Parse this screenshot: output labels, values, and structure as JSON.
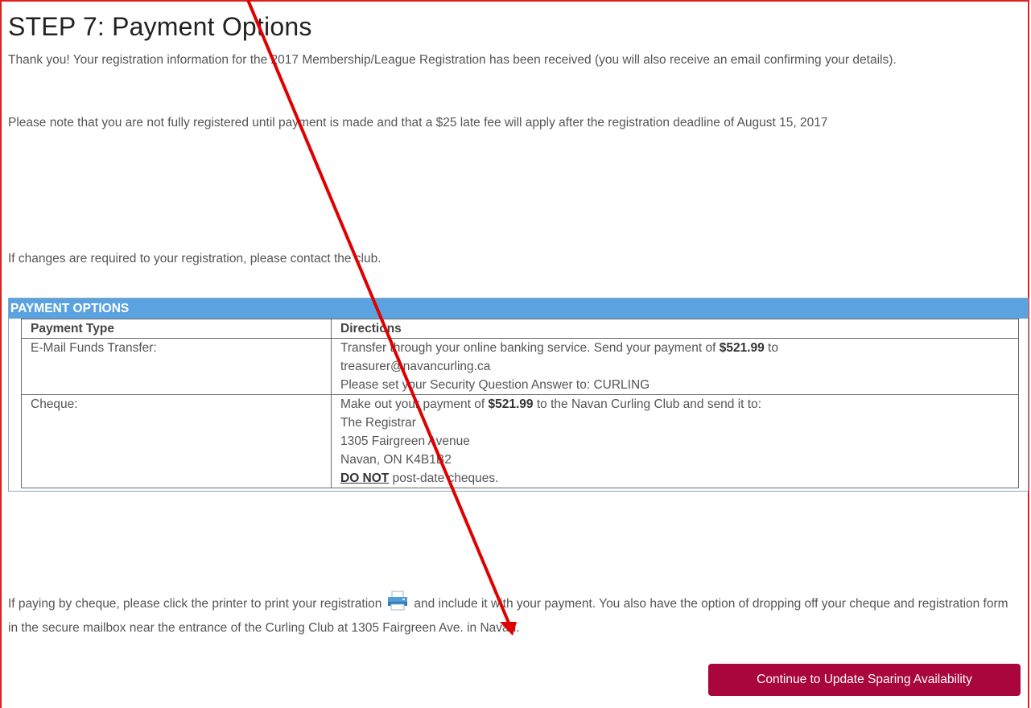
{
  "heading": "STEP 7: Payment Options",
  "paragraphs": {
    "thanks": "Thank you! Your registration information for the 2017 Membership/League Registration has been received (you will also receive an email confirming your details).",
    "note": "Please note that you are not fully registered until payment is made and that a $25 late fee will apply after the registration deadline of August 15, 2017",
    "changes": "If changes are required to your registration, please contact the club."
  },
  "payment": {
    "section_title": "PAYMENT OPTIONS",
    "col_type": "Payment Type",
    "col_directions": "Directions",
    "etransfer": {
      "type": "E-Mail Funds Transfer:",
      "line1_pre": "Transfer through your online banking service. Send your payment of ",
      "amount": "$521.99",
      "line1_post": " to",
      "email": "treasurer@navancurling.ca",
      "line3": "Please set your Security Question Answer to: CURLING"
    },
    "cheque": {
      "type": "Cheque:",
      "line1_pre": "Make out your payment of ",
      "amount": "$521.99",
      "line1_post": " to the Navan Curling Club and send it to:",
      "addr1": "The Registrar",
      "addr2": "1305 Fairgreen Avenue",
      "addr3": "Navan, ON K4B1B2",
      "warn_bold": "DO NOT",
      "warn_rest": " post-date cheques."
    }
  },
  "print_note": {
    "before": "If paying by cheque, please click the printer to print your registration",
    "after": "and include it with your payment. You also have the option of dropping off your cheque and registration form in the secure mailbox near the entrance of the Curling Club at 1305 Fairgreen Ave. in Navan.",
    "icon": "printer-icon"
  },
  "continue_button": "Continue to Update Sparing Availability",
  "colors": {
    "frame": "#e02020",
    "section_header": "#5aa3e0",
    "button": "#a8063c",
    "annotation_arrow": "#e00000"
  }
}
